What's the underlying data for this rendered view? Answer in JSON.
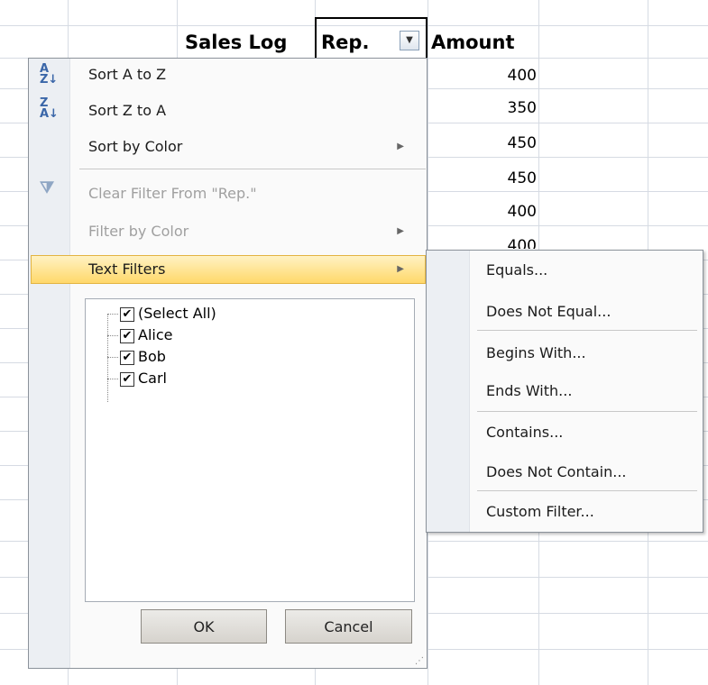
{
  "sheet": {
    "headers": {
      "title": "Sales Log",
      "rep": "Rep.",
      "amount": "Amount"
    },
    "amounts": [
      "400",
      "350",
      "450",
      "450",
      "400",
      "400"
    ]
  },
  "menu": {
    "sort_az": "Sort A to Z",
    "sort_za": "Sort Z to A",
    "sort_by_color": "Sort by Color",
    "clear_filter": "Clear Filter From \"Rep.\"",
    "filter_by_color": "Filter by Color",
    "text_filters": "Text Filters",
    "items": [
      "(Select All)",
      "Alice",
      "Bob",
      "Carl"
    ],
    "ok": "OK",
    "cancel": "Cancel"
  },
  "submenu": {
    "items": [
      "Equals...",
      "Does Not Equal...",
      "Begins With...",
      "Ends With...",
      "Contains...",
      "Does Not Contain...",
      "Custom Filter..."
    ]
  },
  "colors": {
    "highlight": "#ffd86a",
    "gridline": "#d6dbe3"
  }
}
